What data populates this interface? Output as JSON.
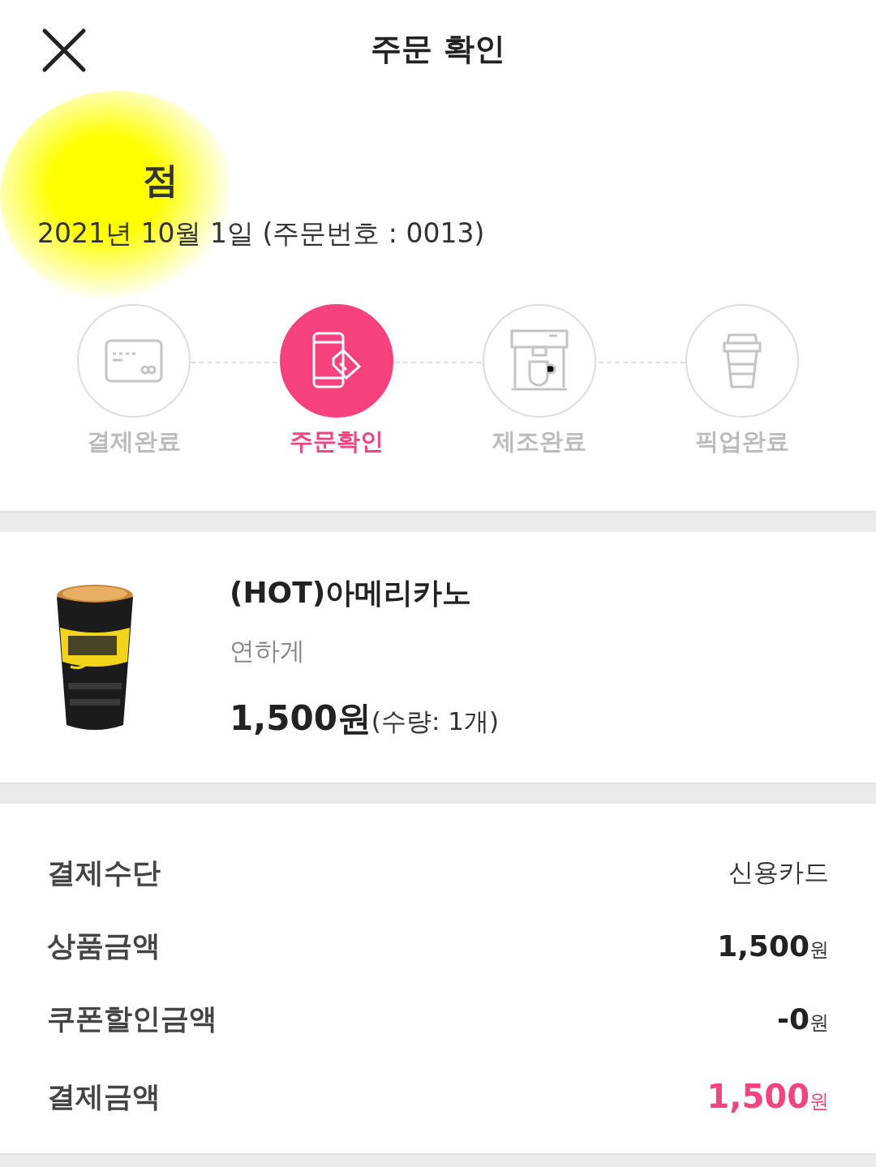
{
  "header": {
    "close_button": true,
    "title": "주문 확인"
  },
  "store": {
    "name": "점",
    "redacted": true,
    "date_line": "2021년 10월 1일 (주문번호 : 0013)"
  },
  "steps": [
    {
      "kind": "card",
      "label": "결제완료",
      "selected": false
    },
    {
      "kind": "phone",
      "label": "주문확인",
      "selected": true
    },
    {
      "kind": "machine",
      "label": "제조완료",
      "selected": false
    },
    {
      "kind": "cup",
      "label": "픽업완료",
      "selected": false
    }
  ],
  "items": [
    {
      "name": "(HOT)아메리카노",
      "option": "연하게",
      "price": "1,500원",
      "quantity": "(수량: 1개)"
    }
  ],
  "summary": [
    {
      "label": "결제수단",
      "value": "신용카드",
      "kind": "text"
    },
    {
      "label": "상품금액",
      "value": "1,500",
      "unit": "원",
      "kind": "amount"
    },
    {
      "label": "쿠폰할인금액",
      "value": "-0",
      "unit": "원",
      "kind": "amount"
    },
    {
      "label": "결제금액",
      "value": "1,500",
      "unit": "원",
      "kind": "total"
    }
  ]
}
